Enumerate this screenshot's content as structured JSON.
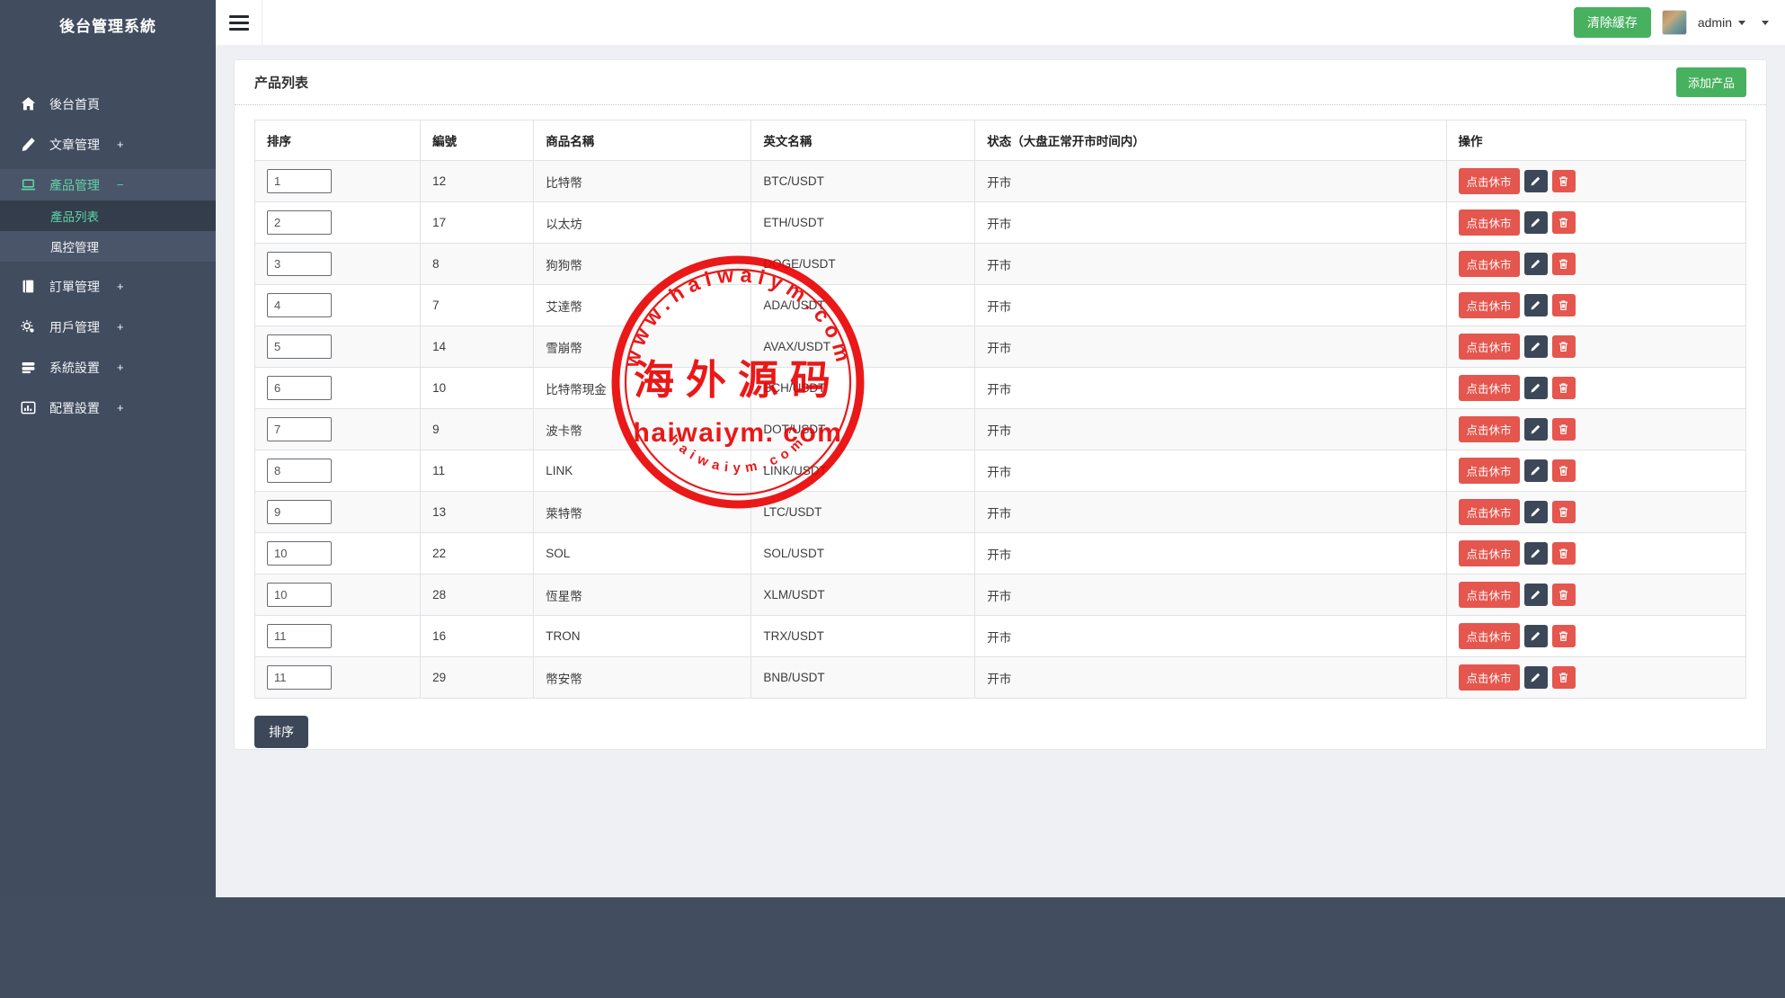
{
  "app": {
    "title": "後台管理系統"
  },
  "header": {
    "clear_cache_label": "清除緩存",
    "username": "admin"
  },
  "sidebar": {
    "items": [
      {
        "label": "後台首頁",
        "suffix": "",
        "icon": "home-icon"
      },
      {
        "label": "文章管理",
        "suffix": "+",
        "icon": "pencil-icon"
      },
      {
        "label": "產品管理",
        "suffix": "−",
        "icon": "laptop-icon",
        "active": true
      },
      {
        "label": "訂單管理",
        "suffix": "+",
        "icon": "book-icon"
      },
      {
        "label": "用戶管理",
        "suffix": "+",
        "icon": "gears-icon"
      },
      {
        "label": "系統設置",
        "suffix": "+",
        "icon": "server-icon"
      },
      {
        "label": "配置設置",
        "suffix": "+",
        "icon": "chart-icon"
      }
    ],
    "sub_items": [
      {
        "label": "產品列表",
        "active": true
      },
      {
        "label": "風控管理",
        "active": false
      }
    ]
  },
  "card": {
    "title": "产品列表",
    "add_button": "添加产品"
  },
  "table": {
    "headers": [
      "排序",
      "編號",
      "商品名稱",
      "英文名稱",
      "状态（大盘正常开市时间内）",
      "操作"
    ],
    "action_close_label": "点击休市",
    "rows": [
      {
        "sort": "1",
        "id": "12",
        "name": "比特幣",
        "en_name": "BTC/USDT",
        "status": "开市"
      },
      {
        "sort": "2",
        "id": "17",
        "name": "以太坊",
        "en_name": "ETH/USDT",
        "status": "开市"
      },
      {
        "sort": "3",
        "id": "8",
        "name": "狗狗幣",
        "en_name": "DOGE/USDT",
        "status": "开市"
      },
      {
        "sort": "4",
        "id": "7",
        "name": "艾達幣",
        "en_name": "ADA/USDT",
        "status": "开市"
      },
      {
        "sort": "5",
        "id": "14",
        "name": "雪崩幣",
        "en_name": "AVAX/USDT",
        "status": "开市"
      },
      {
        "sort": "6",
        "id": "10",
        "name": "比特幣現金",
        "en_name": "BCH/USDT",
        "status": "开市"
      },
      {
        "sort": "7",
        "id": "9",
        "name": "波卡幣",
        "en_name": "DOT/USDT",
        "status": "开市"
      },
      {
        "sort": "8",
        "id": "11",
        "name": "LINK",
        "en_name": "LINK/USDT",
        "status": "开市"
      },
      {
        "sort": "9",
        "id": "13",
        "name": "萊特幣",
        "en_name": "LTC/USDT",
        "status": "开市"
      },
      {
        "sort": "10",
        "id": "22",
        "name": "SOL",
        "en_name": "SOL/USDT",
        "status": "开市"
      },
      {
        "sort": "10",
        "id": "28",
        "name": "恆星幣",
        "en_name": "XLM/USDT",
        "status": "开市"
      },
      {
        "sort": "11",
        "id": "16",
        "name": "TRON",
        "en_name": "TRX/USDT",
        "status": "开市"
      },
      {
        "sort": "11",
        "id": "29",
        "name": "幣安幣",
        "en_name": "BNB/USDT",
        "status": "开市"
      }
    ],
    "sort_submit_label": "排序"
  },
  "watermark": {
    "top_text": "www.haiwaiym.com",
    "center_text": "海外源码",
    "middle_text": "haiwaiym. com",
    "bottom_text": "haiwaiym.com"
  },
  "colors": {
    "green_button": "#47b15f",
    "red_button": "#e4564e",
    "navy_button": "#3c4858",
    "sidebar_bg": "#414c5f",
    "sidebar_accent": "#5fd3a6",
    "page_bg": "#eef0f4",
    "watermark_red": "#e90000",
    "stripe_row": "#f9f9f9"
  }
}
